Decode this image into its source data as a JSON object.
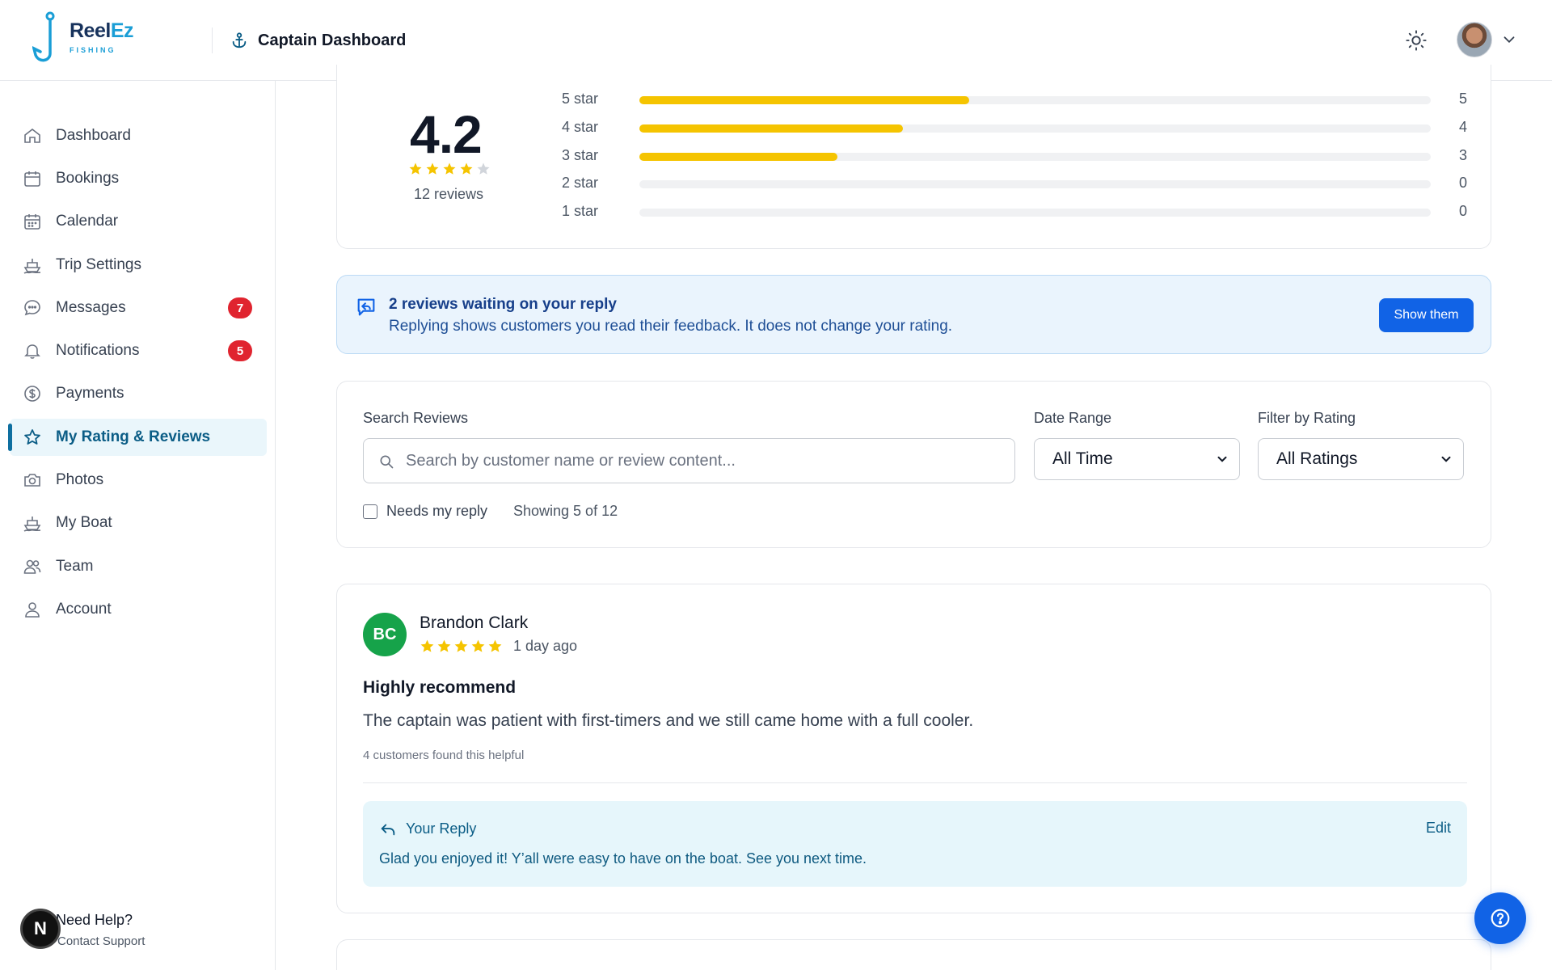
{
  "brand": {
    "name_part1": "Reel",
    "name_part2": "Ez",
    "tagline": "FISHING"
  },
  "header": {
    "title": "Captain Dashboard"
  },
  "sidebar": {
    "items": [
      {
        "label": "Dashboard",
        "icon": "home-icon"
      },
      {
        "label": "Bookings",
        "icon": "calendar-icon"
      },
      {
        "label": "Calendar",
        "icon": "calendar-grid-icon"
      },
      {
        "label": "Trip Settings",
        "icon": "boat-icon"
      },
      {
        "label": "Messages",
        "icon": "chat-icon",
        "badge": "7"
      },
      {
        "label": "Notifications",
        "icon": "bell-icon",
        "badge": "5"
      },
      {
        "label": "Payments",
        "icon": "dollar-icon"
      },
      {
        "label": "My Rating & Reviews",
        "icon": "star-icon",
        "active": true
      },
      {
        "label": "Photos",
        "icon": "camera-icon"
      },
      {
        "label": "My Boat",
        "icon": "boat-icon"
      },
      {
        "label": "Team",
        "icon": "users-icon"
      },
      {
        "label": "Account",
        "icon": "user-icon"
      }
    ],
    "help": {
      "title": "Need Help?",
      "subtitle": "Contact Support",
      "badge_letter": "N"
    }
  },
  "rating_summary": {
    "average": "4.2",
    "stars_filled": 4,
    "stars_total": 5,
    "review_count_label": "12 reviews",
    "breakdown": [
      {
        "label": "5 star",
        "count": "5",
        "fraction": 0.417
      },
      {
        "label": "4 star",
        "count": "4",
        "fraction": 0.333
      },
      {
        "label": "3 star",
        "count": "3",
        "fraction": 0.25
      },
      {
        "label": "2 star",
        "count": "0",
        "fraction": 0
      },
      {
        "label": "1 star",
        "count": "0",
        "fraction": 0
      }
    ]
  },
  "notice": {
    "title": "2 reviews waiting on your reply",
    "text": "Replying shows customers you read their feedback. It does not change your rating.",
    "button": "Show them"
  },
  "filters": {
    "search_label": "Search Reviews",
    "search_placeholder": "Search by customer name or review content...",
    "date_label": "Date Range",
    "date_value": "All Time",
    "rating_label": "Filter by Rating",
    "rating_value": "All Ratings",
    "needs_reply_label": "Needs my reply",
    "needs_reply_checked": false,
    "showing": "Showing 5 of 12"
  },
  "reviews": [
    {
      "initials": "BC",
      "name": "Brandon Clark",
      "stars": 5,
      "time": "1 day ago",
      "title": "Highly recommend",
      "body": "The captain was patient with first-timers and we still came home with a full cooler.",
      "helpful": "4 customers found this helpful",
      "reply": {
        "heading": "Your Reply",
        "edit_label": "Edit",
        "text": "Glad you enjoyed it! Y’all were easy to have on the boat. See you next time."
      }
    }
  ],
  "colors": {
    "accent": "#1163e6",
    "star": "#f5c400",
    "active_nav": "#0b5d86",
    "badge": "#e0242f"
  }
}
